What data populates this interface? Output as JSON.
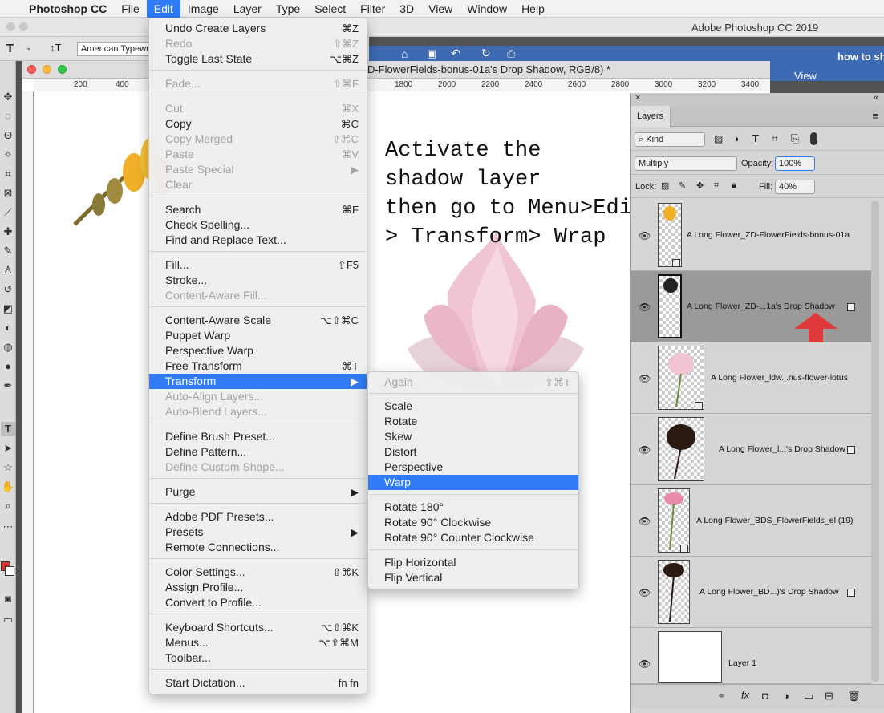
{
  "menubar": {
    "app": "Photoshop CC",
    "items": [
      "File",
      "Edit",
      "Image",
      "Layer",
      "Type",
      "Select",
      "Filter",
      "3D",
      "View",
      "Window",
      "Help"
    ],
    "active": "Edit"
  },
  "window": {
    "app_title": "Adobe Photoshop CC 2019"
  },
  "options_bar": {
    "font": "American Typewriter"
  },
  "document": {
    "title": "D-FlowerFields-bonus-01a's Drop Shadow, RGB/8) *",
    "ruler_ticks": [
      "200",
      "400",
      "1800",
      "2000",
      "2200",
      "2400",
      "2600",
      "2800",
      "3000",
      "3200",
      "3400"
    ]
  },
  "background_app": {
    "title": "how to sh",
    "tab": "View"
  },
  "instruction_text": [
    "Activate the",
    "shadow layer",
    "then go to Menu>Edit",
    "> Transform> Wrap"
  ],
  "edit_menu": [
    {
      "label": "Undo Create Layers",
      "shortcut": "⌘Z"
    },
    {
      "label": "Redo",
      "shortcut": "⇧⌘Z",
      "disabled": true
    },
    {
      "label": "Toggle Last State",
      "shortcut": "⌥⌘Z"
    },
    {
      "label": "Fade...",
      "shortcut": "⇧⌘F",
      "disabled": true
    },
    {
      "label": "Cut",
      "shortcut": "⌘X",
      "disabled": true
    },
    {
      "label": "Copy",
      "shortcut": "⌘C"
    },
    {
      "label": "Copy Merged",
      "shortcut": "⇧⌘C",
      "disabled": true
    },
    {
      "label": "Paste",
      "shortcut": "⌘V",
      "disabled": true
    },
    {
      "label": "Paste Special",
      "shortcut": "▶",
      "disabled": true
    },
    {
      "label": "Clear",
      "shortcut": "",
      "disabled": true
    },
    {
      "label": "Search",
      "shortcut": "⌘F"
    },
    {
      "label": "Check Spelling...",
      "shortcut": ""
    },
    {
      "label": "Find and Replace Text...",
      "shortcut": ""
    },
    {
      "label": "Fill...",
      "shortcut": "⇧F5"
    },
    {
      "label": "Stroke...",
      "shortcut": ""
    },
    {
      "label": "Content-Aware Fill...",
      "shortcut": "",
      "disabled": true
    },
    {
      "label": "Content-Aware Scale",
      "shortcut": "⌥⇧⌘C"
    },
    {
      "label": "Puppet Warp",
      "shortcut": ""
    },
    {
      "label": "Perspective Warp",
      "shortcut": ""
    },
    {
      "label": "Free Transform",
      "shortcut": "⌘T"
    },
    {
      "label": "Transform",
      "shortcut": "▶",
      "highlighted": true
    },
    {
      "label": "Auto-Align Layers...",
      "shortcut": "",
      "disabled": true
    },
    {
      "label": "Auto-Blend Layers...",
      "shortcut": "",
      "disabled": true
    },
    {
      "label": "Define Brush Preset...",
      "shortcut": ""
    },
    {
      "label": "Define Pattern...",
      "shortcut": ""
    },
    {
      "label": "Define Custom Shape...",
      "shortcut": "",
      "disabled": true
    },
    {
      "label": "Purge",
      "shortcut": "▶"
    },
    {
      "label": "Adobe PDF Presets...",
      "shortcut": ""
    },
    {
      "label": "Presets",
      "shortcut": "▶"
    },
    {
      "label": "Remote Connections...",
      "shortcut": ""
    },
    {
      "label": "Color Settings...",
      "shortcut": "⇧⌘K"
    },
    {
      "label": "Assign Profile...",
      "shortcut": ""
    },
    {
      "label": "Convert to Profile...",
      "shortcut": ""
    },
    {
      "label": "Keyboard Shortcuts...",
      "shortcut": "⌥⇧⌘K"
    },
    {
      "label": "Menus...",
      "shortcut": "⌥⇧⌘M"
    },
    {
      "label": "Toolbar...",
      "shortcut": ""
    },
    {
      "label": "Start Dictation...",
      "shortcut": "fn fn"
    }
  ],
  "transform_menu": [
    {
      "label": "Again",
      "shortcut": "⇧⌘T",
      "disabled": true
    },
    {
      "label": "Scale"
    },
    {
      "label": "Rotate"
    },
    {
      "label": "Skew"
    },
    {
      "label": "Distort"
    },
    {
      "label": "Perspective"
    },
    {
      "label": "Warp",
      "highlighted": true
    },
    {
      "label": "Rotate 180°"
    },
    {
      "label": "Rotate 90° Clockwise"
    },
    {
      "label": "Rotate 90° Counter Clockwise"
    },
    {
      "label": "Flip Horizontal"
    },
    {
      "label": "Flip Vertical"
    }
  ],
  "layers_panel": {
    "tab": "Layers",
    "filter": "Kind",
    "blend_mode": "Multiply",
    "opacity_label": "Opacity:",
    "opacity": "100%",
    "lock_label": "Lock:",
    "fill_label": "Fill:",
    "fill": "40%",
    "layers": [
      {
        "name": "A Long Flower_ZD-FlowerFields-bonus-01a",
        "selected": false
      },
      {
        "name": "A Long Flower_ZD-...1a's Drop Shadow",
        "selected": true
      },
      {
        "name": "A Long Flower_ldw...nus-flower-lotus",
        "selected": false
      },
      {
        "name": "A Long Flower_l...'s Drop Shadow",
        "selected": false
      },
      {
        "name": "A Long Flower_BDS_FlowerFields_el (19)",
        "selected": false
      },
      {
        "name": "A Long Flower_BD...)'s Drop Shadow",
        "selected": false
      },
      {
        "name": "Layer 1",
        "selected": false
      }
    ]
  },
  "colors": {
    "accent": "#2f7cf6",
    "arrow": "#e0393a",
    "panel": "#d6d6d6"
  }
}
